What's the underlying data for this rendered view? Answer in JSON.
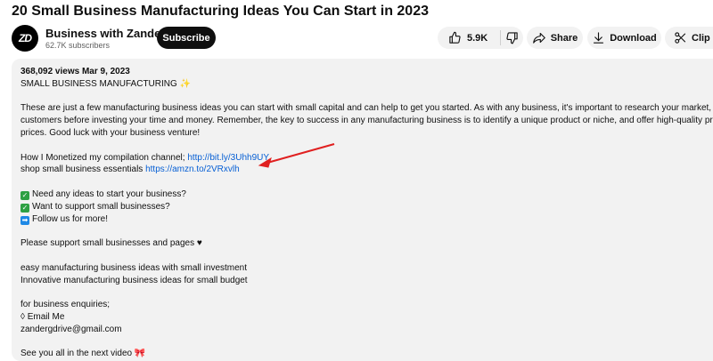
{
  "video": {
    "title": "20 Small Business Manufacturing Ideas You Can Start in 2023"
  },
  "channel": {
    "avatar_text": "ZD",
    "name": "Business with Zander",
    "subscribers": "62.7K subscribers"
  },
  "actions": {
    "subscribe": "Subscribe",
    "like_count": "5.9K",
    "share": "Share",
    "download": "Download",
    "clip": "Clip"
  },
  "description": {
    "stats": "368,092 views  Mar 9, 2023",
    "headline": "SMALL BUSINESS MANUFACTURING ✨",
    "para_1": "These are just a few manufacturing business ideas you can start with small capital and can help to get you started. As with any business, it's important to research your market, comp",
    "para_2": "customers before investing your time and money. Remember, the key to success in any manufacturing business is to identify a unique product or niche, and offer high-quality products",
    "para_3": "prices. Good luck with your business venture!",
    "monetized_prefix": "How I Monetized my compilation channel; ",
    "monetized_link": "http://bit.ly/3Uhh9UY",
    "shop_prefix": "shop small business essentials ",
    "shop_link": "https://amzn.to/2VRxvlh",
    "check_1": "Need any ideas to start your business?",
    "check_2": "Want to support small businesses?",
    "follow": "Follow us for more!",
    "support": "Please support small businesses and pages ♥",
    "ideas_1": "easy manufacturing business ideas with small investment",
    "ideas_2": "Innovative manufacturing business ideas for small budget",
    "enquiries": "for business enquiries;",
    "email_label": "◊ Email Me",
    "email": "zandergdrive@gmail.com",
    "see_you": "See you all in the next video  🎀"
  },
  "colors": {
    "link": "#065fd4",
    "annotation_arrow": "#e02020",
    "panel": "#f2f2f2"
  },
  "icons": [
    "thumbs-up-icon",
    "thumbs-down-icon",
    "share-icon",
    "download-icon",
    "scissors-icon",
    "check-box-icon",
    "arrow-box-icon"
  ]
}
